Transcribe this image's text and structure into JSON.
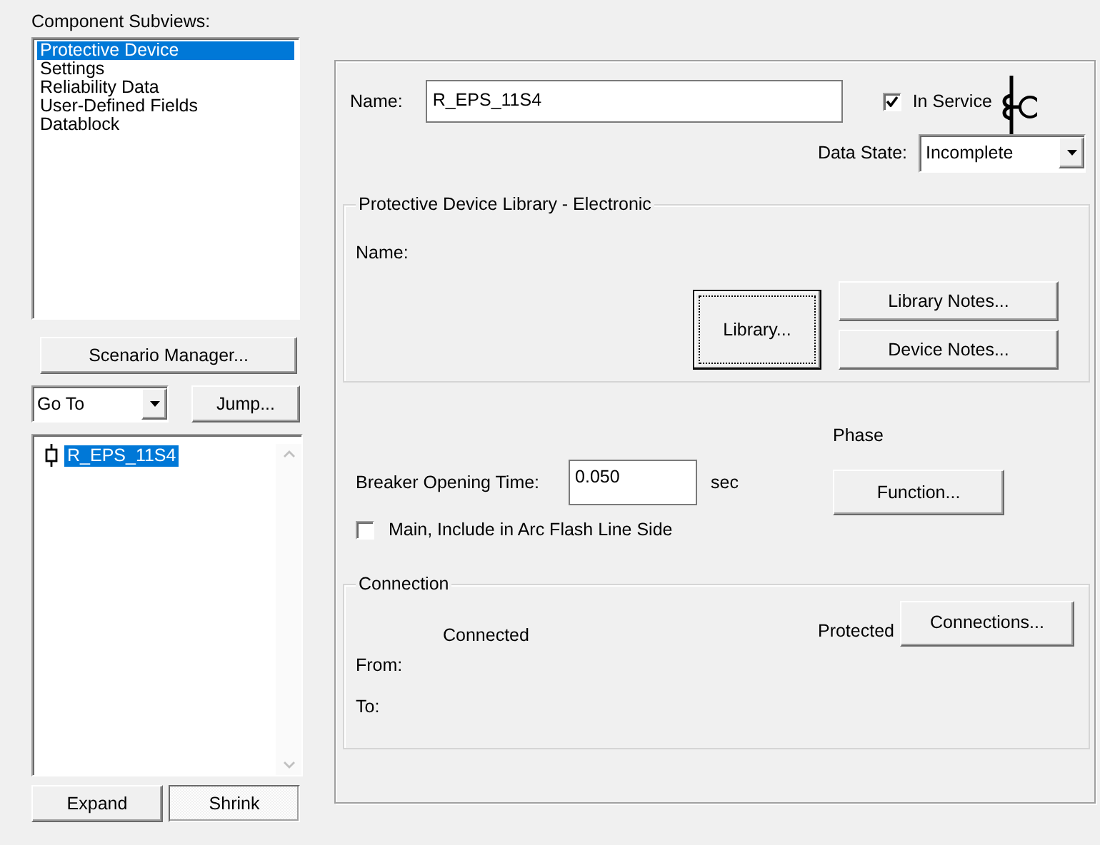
{
  "subviews": {
    "label": "Component Subviews:",
    "items": [
      {
        "label": "Protective Device",
        "selected": true
      },
      {
        "label": "Settings",
        "selected": false
      },
      {
        "label": "Reliability Data",
        "selected": false
      },
      {
        "label": "User-Defined Fields",
        "selected": false
      },
      {
        "label": "Datablock",
        "selected": false
      }
    ]
  },
  "scenario_button": "Scenario Manager...",
  "goto": {
    "value": "Go To",
    "button": "Jump..."
  },
  "tree": {
    "items": [
      {
        "label": "R_EPS_11S4",
        "selected": true
      }
    ]
  },
  "tree_buttons": [
    {
      "label": "Expand",
      "pressed": false
    },
    {
      "label": "Shrink",
      "pressed": true
    }
  ],
  "device": {
    "name_label": "Name:",
    "name": "R_EPS_11S4",
    "in_service": {
      "label": "In Service",
      "checked": true
    },
    "data_state": {
      "label": "Data State:",
      "value": "Incomplete"
    }
  },
  "library": {
    "title": "Protective Device Library - Electronic",
    "name_label": "Name:",
    "buttons": [
      {
        "label": "Library...",
        "focused": true
      },
      {
        "label": "Library Notes...",
        "focused": false
      },
      {
        "label": "Device Notes...",
        "focused": false
      }
    ]
  },
  "breaker": {
    "label": "Breaker Opening Time:",
    "value": "0.050",
    "unit": "sec"
  },
  "phase": {
    "label": "Phase",
    "button": "Function..."
  },
  "arc_flash": {
    "label": "Main, Include in Arc Flash Line Side",
    "checked": false
  },
  "connection": {
    "title": "Connection",
    "connected_label": "Connected",
    "protected_label": "Protected",
    "button": "Connections...",
    "from_label": "From:",
    "to_label": "To:"
  }
}
